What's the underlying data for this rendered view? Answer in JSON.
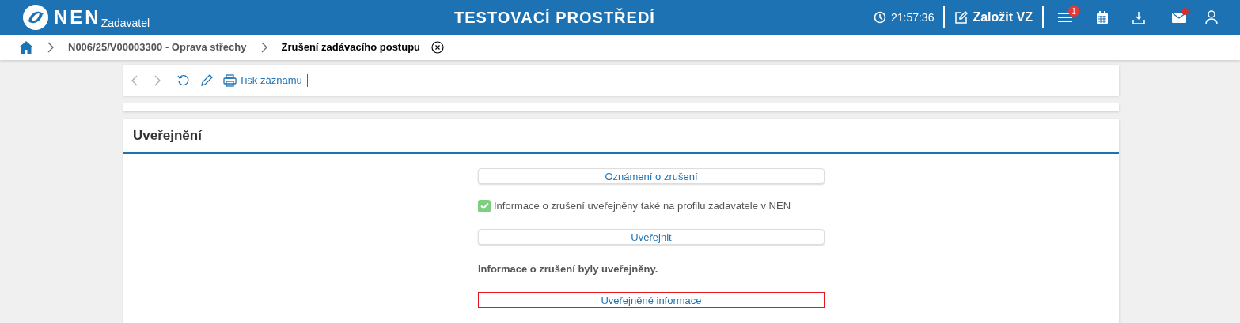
{
  "header": {
    "logo_text": "NEN",
    "logo_subtitle": "Zadavatel",
    "title": "TESTOVACÍ PROSTŘEDÍ",
    "clock": "21:57:36",
    "create_button": "Založit VZ",
    "menu_badge": "1",
    "mail_unread": true
  },
  "breadcrumbs": [
    {
      "label": "N006/25/V00003300 - Oprava střechy",
      "current": false
    },
    {
      "label": "Zrušení zadávacího postupu",
      "current": true
    }
  ],
  "toolbar": {
    "back_disabled": true,
    "forward_disabled": true,
    "print_label": "Tisk záznamu"
  },
  "section": {
    "title": "Uveřejnění",
    "items": [
      {
        "kind": "button",
        "label": "Oznámení o zrušení",
        "focused": false
      },
      {
        "kind": "checkbox",
        "label": "Informace o zrušení uveřejněny také na profilu zadavatele v NEN",
        "checked": true
      },
      {
        "kind": "button",
        "label": "Uveřejnit",
        "focused": false
      },
      {
        "kind": "message",
        "label": "Informace o zrušení byly uveřejněny."
      },
      {
        "kind": "button",
        "label": "Uveřejněné informace",
        "focused": true
      }
    ]
  }
}
